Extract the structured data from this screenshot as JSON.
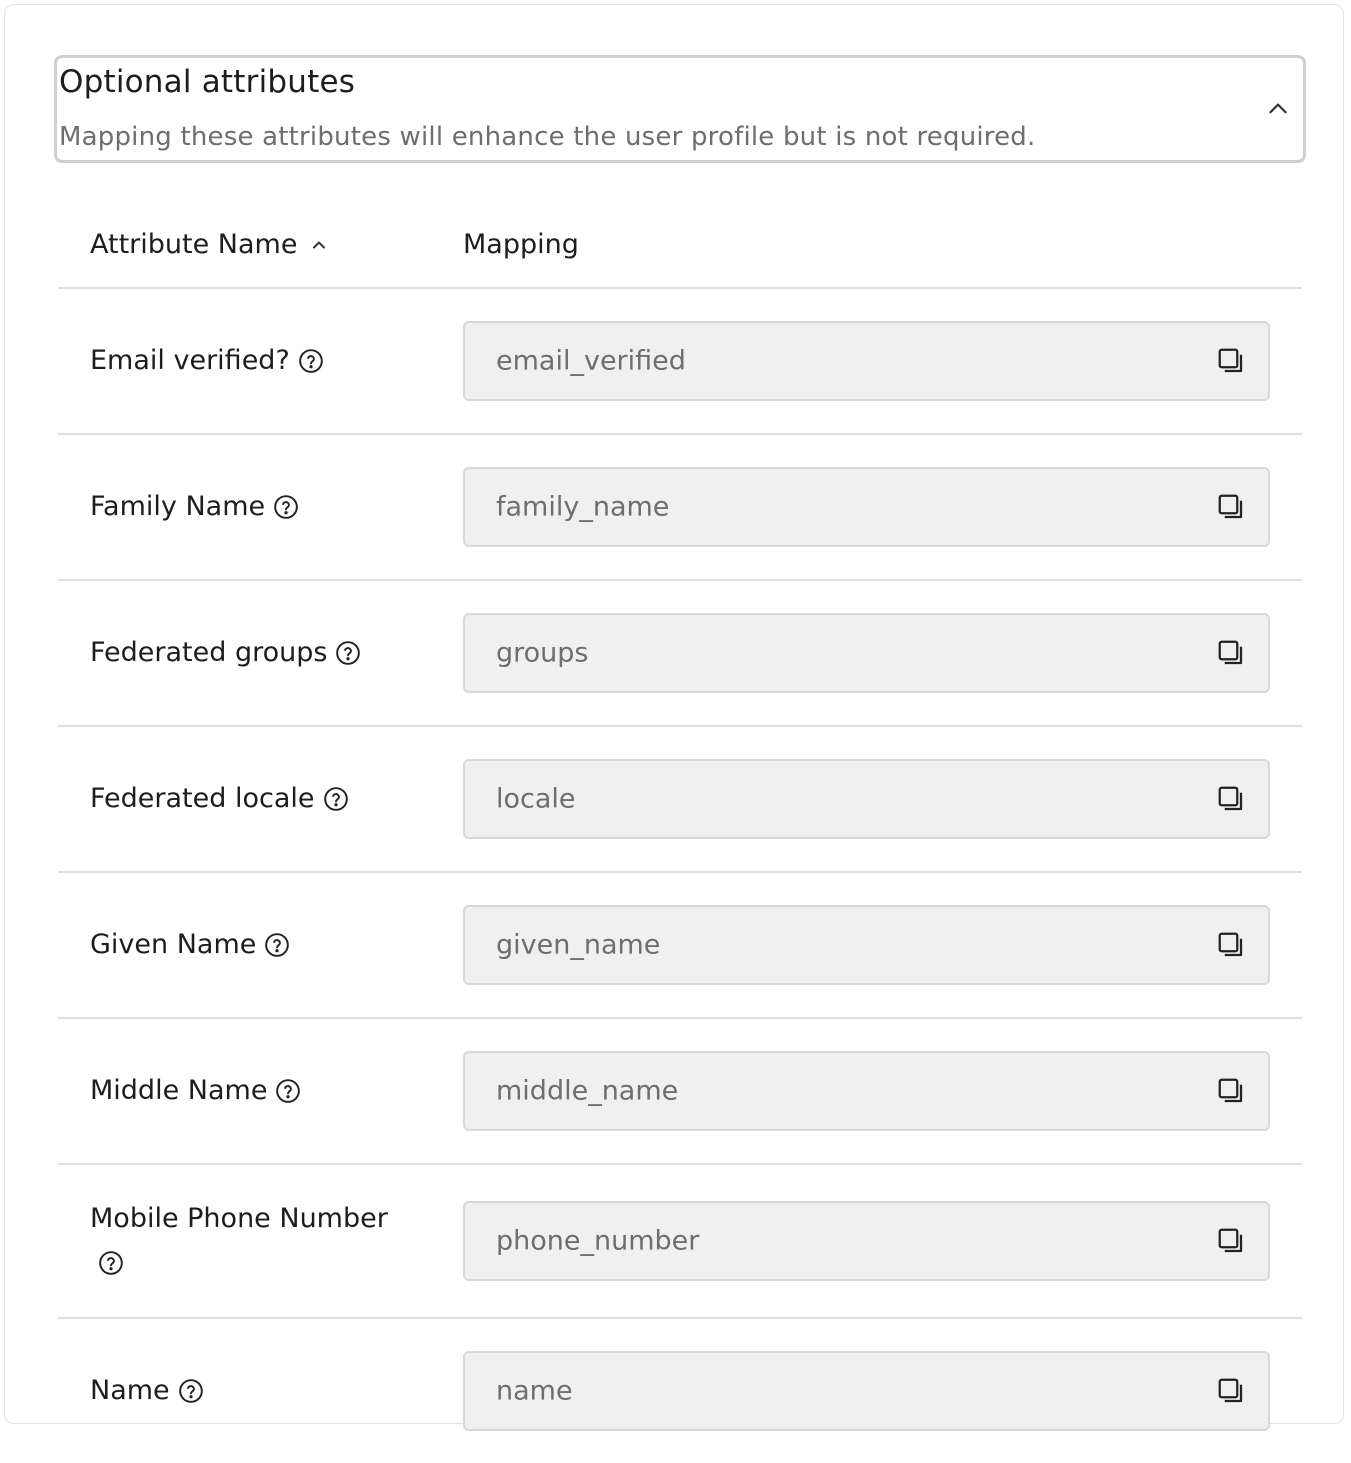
{
  "section": {
    "title": "Optional attributes",
    "description": "Mapping these attributes will enhance the user profile but is not required.",
    "collapse_icon": "chevron-up-icon"
  },
  "table": {
    "headers": {
      "name": "Attribute Name",
      "mapping": "Mapping"
    },
    "sort": "ascending",
    "rows": [
      {
        "name": "Email verified?",
        "mapping": "email_verified"
      },
      {
        "name": "Family Name",
        "mapping": "family_name"
      },
      {
        "name": "Federated groups",
        "mapping": "groups"
      },
      {
        "name": "Federated locale",
        "mapping": "locale"
      },
      {
        "name": "Given Name",
        "mapping": "given_name"
      },
      {
        "name": "Middle Name",
        "mapping": "middle_name"
      },
      {
        "name": "Mobile Phone Number",
        "mapping": "phone_number"
      },
      {
        "name": "Name",
        "mapping": "name"
      }
    ]
  },
  "icons": {
    "help": "help-circle-icon",
    "copy": "copy-icon",
    "sort": "chevron-up-icon"
  },
  "colors": {
    "field_bg": "#f0f0f0",
    "field_border": "#d8d8d8",
    "divider": "#dedede",
    "muted_text": "#6e6e6e"
  }
}
